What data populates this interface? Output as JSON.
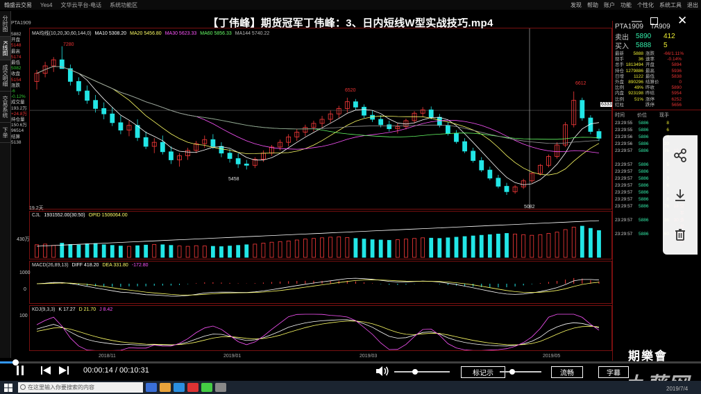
{
  "video": {
    "title": "【丁伟峰】期货冠军丁伟峰：3、日内短线W型实战技巧.mp4",
    "current_time": "00:00:14",
    "total_time": "00:10:31",
    "progress": 0.022,
    "volume": 0.37,
    "buttons": {
      "mark": "标记示",
      "danmaku": "流畅",
      "subtitle": "字幕"
    }
  },
  "app": {
    "title": "翰盛云交易",
    "menus": [
      "Yes4",
      "文华云平台-电话",
      "系统功能区"
    ],
    "right_menus": [
      "发现",
      "帮助",
      "账户",
      "功能",
      "个性化",
      "系统工具",
      "退出"
    ]
  },
  "sidebar": {
    "tabs": [
      "分时图",
      "K线图",
      "成交明细",
      "交易系统",
      "下单"
    ]
  },
  "symbol_bar": "PTA1909",
  "left_stats": [
    {
      "label": "5882",
      "cls": ""
    },
    {
      "label": "开盘",
      "cls": ""
    },
    {
      "label": "5148",
      "cls": "up"
    },
    {
      "label": "最高",
      "cls": ""
    },
    {
      "label": "5174",
      "cls": "up"
    },
    {
      "label": "最低",
      "cls": ""
    },
    {
      "label": "5082",
      "cls": "down"
    },
    {
      "label": "收盘",
      "cls": ""
    },
    {
      "label": "5154",
      "cls": "up"
    },
    {
      "label": "涨跌",
      "cls": ""
    },
    {
      "label": "-6",
      "cls": "down"
    },
    {
      "label": "-0.12%",
      "cls": "down"
    },
    {
      "label": "成交量",
      "cls": ""
    },
    {
      "label": "193.2万",
      "cls": ""
    },
    {
      "label": "+24.8万",
      "cls": "up"
    },
    {
      "label": "持仓量",
      "cls": ""
    },
    {
      "label": "150.6万",
      "cls": ""
    },
    {
      "label": "96514",
      "cls": ""
    },
    {
      "label": "结算",
      "cls": ""
    },
    {
      "label": "5138",
      "cls": ""
    }
  ],
  "indicators": {
    "price": [
      {
        "text": "MA均线(10,20,30,60,144,0)",
        "color": "#dddddd"
      },
      {
        "text": "MA10 5308.20",
        "color": "#ffffff"
      },
      {
        "text": "MA20 5456.80",
        "color": "#ffff66"
      },
      {
        "text": "MA30 5623.33",
        "color": "#ff55ff"
      },
      {
        "text": "MA60 5856.33",
        "color": "#66ff66"
      },
      {
        "text": "MA144 5740.22",
        "color": "#bbbbbb"
      }
    ],
    "volume": [
      {
        "text": "CJL",
        "color": "#dddddd"
      },
      {
        "text": "1931552.00(30:50)",
        "color": "#ffffff"
      },
      {
        "text": "OPID 1506064.00",
        "color": "#ffff66"
      }
    ],
    "macd": [
      {
        "text": "MACD(26,89,13)",
        "color": "#dddddd"
      },
      {
        "text": "DIFF 418.20",
        "color": "#ffffff"
      },
      {
        "text": "DEA 331.80",
        "color": "#ffff66"
      },
      {
        "text": "-172.80",
        "color": "#ff55ff"
      }
    ],
    "kdj": [
      {
        "text": "KDJ(9,3,3)",
        "color": "#dddddd"
      },
      {
        "text": "K 17.27",
        "color": "#ffffff"
      },
      {
        "text": "D 21.70",
        "color": "#ffff66"
      },
      {
        "text": "J 8.42",
        "color": "#ff55ff"
      }
    ]
  },
  "price_labels": {
    "high1": "6520",
    "high2": "6612",
    "low1": "5458",
    "low2": "5082",
    "peak_left": "7280",
    "right_axis": "6333",
    "volume_axis": "430万",
    "macd_axis": "1000",
    "macd_axis2": "0",
    "kdj_axis": "100",
    "volume_label": "19.2天"
  },
  "x_axis": [
    "2018/11",
    "2019/01",
    "2019/03",
    "2019/05"
  ],
  "chart_data": {
    "type": "candlestick",
    "series": "PTA1909 daily",
    "candles": [
      [
        6760,
        6930,
        6640,
        6880
      ],
      [
        6880,
        7050,
        6820,
        6990
      ],
      [
        6990,
        7120,
        6900,
        7080
      ],
      [
        7080,
        7280,
        6980,
        6950
      ],
      [
        6950,
        7010,
        6700,
        6760
      ],
      [
        6760,
        6820,
        6560,
        6620
      ],
      [
        6620,
        6700,
        6430,
        6480
      ],
      [
        6480,
        6560,
        6300,
        6360
      ],
      [
        6360,
        6450,
        6200,
        6280
      ],
      [
        6280,
        6380,
        6100,
        6150
      ],
      [
        6150,
        6250,
        5980,
        6040
      ],
      [
        6040,
        6180,
        5950,
        6110
      ],
      [
        6110,
        6200,
        5880,
        5930
      ],
      [
        5930,
        6020,
        5760,
        5800
      ],
      [
        5800,
        5920,
        5700,
        5860
      ],
      [
        5860,
        5960,
        5680,
        5720
      ],
      [
        5720,
        5800,
        5540,
        5600
      ],
      [
        5600,
        5700,
        5500,
        5660
      ],
      [
        5660,
        5780,
        5600,
        5740
      ],
      [
        5740,
        5880,
        5700,
        5840
      ],
      [
        5840,
        5960,
        5780,
        5900
      ],
      [
        5900,
        5980,
        5760,
        5800
      ],
      [
        5800,
        5860,
        5640,
        5700
      ],
      [
        5700,
        5760,
        5560,
        5620
      ],
      [
        5620,
        5700,
        5480,
        5540
      ],
      [
        5540,
        5600,
        5458,
        5520
      ],
      [
        5520,
        5640,
        5480,
        5610
      ],
      [
        5610,
        5740,
        5570,
        5700
      ],
      [
        5700,
        5820,
        5660,
        5790
      ],
      [
        5790,
        5900,
        5740,
        5860
      ],
      [
        5860,
        5980,
        5800,
        5940
      ],
      [
        5940,
        6060,
        5880,
        6010
      ],
      [
        6010,
        6120,
        5950,
        6080
      ],
      [
        6080,
        6180,
        6020,
        6140
      ],
      [
        6140,
        6250,
        6080,
        6200
      ],
      [
        6200,
        6330,
        6150,
        6280
      ],
      [
        6280,
        6400,
        6220,
        6360
      ],
      [
        6360,
        6520,
        6300,
        6460
      ],
      [
        6460,
        6500,
        6340,
        6380
      ],
      [
        6380,
        6420,
        6220,
        6260
      ],
      [
        6260,
        6330,
        6160,
        6200
      ],
      [
        6200,
        6260,
        6080,
        6120
      ],
      [
        6120,
        6180,
        6020,
        6060
      ],
      [
        6060,
        6140,
        5990,
        6090
      ],
      [
        6090,
        6210,
        6050,
        6180
      ],
      [
        6180,
        6320,
        6140,
        6290
      ],
      [
        6290,
        6380,
        6240,
        6340
      ],
      [
        6340,
        6390,
        6200,
        6230
      ],
      [
        6230,
        6280,
        6080,
        6110
      ],
      [
        6110,
        6160,
        5960,
        5990
      ],
      [
        5990,
        6040,
        5840,
        5870
      ],
      [
        5870,
        5920,
        5700,
        5730
      ],
      [
        5730,
        5780,
        5560,
        5590
      ],
      [
        5590,
        5640,
        5420,
        5450
      ],
      [
        5450,
        5500,
        5300,
        5330
      ],
      [
        5330,
        5380,
        5180,
        5210
      ],
      [
        5210,
        5260,
        5082,
        5130
      ],
      [
        5130,
        5230,
        5100,
        5200
      ],
      [
        5200,
        5320,
        5170,
        5290
      ],
      [
        5290,
        5420,
        5260,
        5400
      ],
      [
        5400,
        5540,
        5370,
        5520
      ],
      [
        5520,
        5680,
        5490,
        5650
      ],
      [
        5650,
        5860,
        5620,
        5820
      ],
      [
        5820,
        6160,
        5790,
        6120
      ],
      [
        6120,
        6612,
        6080,
        6480
      ],
      [
        6480,
        6520,
        6180,
        6220
      ],
      [
        6220,
        6260,
        5980,
        6020
      ],
      [
        6020,
        6060,
        5880,
        5920
      ]
    ],
    "volume": [
      40,
      42,
      38,
      45,
      41,
      39,
      43,
      44,
      40,
      38,
      36,
      35,
      37,
      39,
      41,
      40,
      38,
      36,
      35,
      37,
      36,
      35,
      34,
      36,
      38,
      40,
      42,
      45,
      48,
      50,
      52,
      55,
      58,
      60,
      62,
      64,
      65,
      63,
      60,
      58,
      56,
      55,
      54,
      56,
      58,
      60,
      62,
      61,
      60,
      62,
      64,
      66,
      68,
      70,
      72,
      74,
      76,
      74,
      72,
      70,
      72,
      76,
      80,
      88,
      96,
      99,
      92,
      85
    ],
    "ylim": [
      5000,
      7400
    ]
  },
  "quote": {
    "contract": "PTA1909",
    "contract2": "TA909",
    "sell_label": "卖出",
    "sell_price": "5890",
    "sell_volume": "412",
    "buy_label": "买入",
    "buy_price": "5888",
    "buy_volume": "5",
    "stats": [
      [
        "最新",
        "5888",
        "涨跌",
        "-66/1.11%"
      ],
      [
        "现手",
        "36",
        "速率",
        "-0.14%"
      ],
      [
        "总手",
        "1813494",
        "开盘",
        "5894"
      ],
      [
        "持仓",
        "1279886",
        "最高",
        "5936"
      ],
      [
        "日增",
        "1122",
        "最低",
        "5838"
      ],
      [
        "外盘",
        "890296",
        "结算价",
        "0"
      ],
      [
        "比例",
        "49%",
        "昨收",
        "5890"
      ],
      [
        "内盘",
        "923198",
        "昨结",
        "5954"
      ],
      [
        "比例",
        "51%",
        "涨停",
        "6252"
      ],
      [
        "红柱",
        "",
        "跌停",
        "5656"
      ]
    ],
    "tick_header": [
      "时间",
      "价位",
      "现手"
    ],
    "ticks": [
      [
        "23:29:55",
        "5886",
        "8",
        ""
      ],
      [
        "23:29:55",
        "5886",
        "6",
        ""
      ],
      [
        "23:29:56",
        "5886",
        "4",
        ""
      ],
      [
        "23:29:56",
        "5886",
        "20",
        ""
      ],
      [
        "23:29:57",
        "5886",
        "76",
        "18 空平"
      ],
      [
        "23:29:57",
        "5886",
        "5",
        ""
      ],
      [
        "23:29:57",
        "5886",
        "2",
        ""
      ],
      [
        "23:29:57",
        "5886",
        "3",
        ""
      ],
      [
        "23:29:57",
        "5886",
        "6",
        ""
      ],
      [
        "23:29:57",
        "5886",
        "1",
        ""
      ],
      [
        "23:29:57",
        "5886",
        "8",
        ""
      ],
      [
        "23:29:57",
        "5886",
        "76",
        "18 空平"
      ],
      [
        "23:29:57",
        "5886",
        "36",
        "30 多平"
      ],
      [
        "23:29:57",
        "5886",
        "60",
        "58 多开"
      ]
    ]
  },
  "taskbar": {
    "search_placeholder": "在这里输入你要搜索的内容"
  },
  "watermark": {
    "brand": "期樂會",
    "site": "九藤网",
    "date": "2019/7/4"
  }
}
